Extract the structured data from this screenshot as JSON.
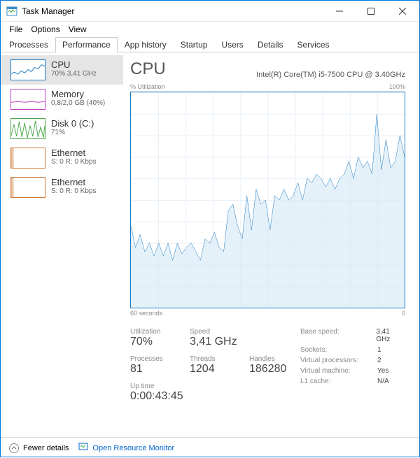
{
  "window": {
    "title": "Task Manager"
  },
  "menu": {
    "file": "File",
    "options": "Options",
    "view": "View"
  },
  "tabs": {
    "processes": "Processes",
    "performance": "Performance",
    "app_history": "App history",
    "startup": "Startup",
    "users": "Users",
    "details": "Details",
    "services": "Services"
  },
  "sidebar": {
    "cpu": {
      "title": "CPU",
      "sub": "70% 3,41 GHz"
    },
    "memory": {
      "title": "Memory",
      "sub": "0,8/2,0 GB (40%)"
    },
    "disk": {
      "title": "Disk 0 (C:)",
      "sub": "71%"
    },
    "eth1": {
      "title": "Ethernet",
      "sub": "S: 0 R: 0 Kbps"
    },
    "eth2": {
      "title": "Ethernet",
      "sub": "S: 0 R: 0 Kbps"
    }
  },
  "main": {
    "title": "CPU",
    "processor": "Intel(R) Core(TM) i5-7500 CPU @ 3.40GHz",
    "y_label": "% Utilization",
    "y_max": "100%",
    "x_left": "60 seconds",
    "x_right": "0"
  },
  "stats": {
    "utilization_label": "Utilization",
    "utilization": "70%",
    "speed_label": "Speed",
    "speed": "3,41 GHz",
    "processes_label": "Processes",
    "processes": "81",
    "threads_label": "Threads",
    "threads": "1204",
    "handles_label": "Handles",
    "handles": "186280",
    "uptime_label": "Up time",
    "uptime": "0:00:43:45",
    "base_speed_k": "Base speed:",
    "base_speed_v": "3,41 GHz",
    "sockets_k": "Sockets:",
    "sockets_v": "1",
    "vprocs_k": "Virtual processors:",
    "vprocs_v": "2",
    "vm_k": "Virtual machine:",
    "vm_v": "Yes",
    "l1_k": "L1 cache:",
    "l1_v": "N/A"
  },
  "footer": {
    "fewer": "Fewer details",
    "orm": "Open Resource Monitor"
  },
  "chart_data": {
    "type": "line",
    "title": "% Utilization",
    "xlabel": "60 seconds",
    "ylabel": "% Utilization",
    "ylim": [
      0,
      100
    ],
    "x": [
      0,
      1,
      2,
      3,
      4,
      5,
      6,
      7,
      8,
      9,
      10,
      11,
      12,
      13,
      14,
      15,
      16,
      17,
      18,
      19,
      20,
      21,
      22,
      23,
      24,
      25,
      26,
      27,
      28,
      29,
      30,
      31,
      32,
      33,
      34,
      35,
      36,
      37,
      38,
      39,
      40,
      41,
      42,
      43,
      44,
      45,
      46,
      47,
      48,
      49,
      50,
      51,
      52,
      53,
      54,
      55,
      56,
      57,
      58,
      59
    ],
    "values": [
      38,
      28,
      34,
      26,
      30,
      24,
      30,
      24,
      30,
      22,
      30,
      25,
      28,
      30,
      26,
      22,
      32,
      30,
      35,
      28,
      26,
      45,
      48,
      38,
      32,
      52,
      36,
      55,
      48,
      50,
      36,
      52,
      50,
      55,
      50,
      52,
      58,
      50,
      60,
      58,
      62,
      60,
      56,
      60,
      55,
      60,
      62,
      68,
      60,
      70,
      65,
      68,
      62,
      90,
      64,
      78,
      65,
      68,
      80,
      70
    ]
  }
}
